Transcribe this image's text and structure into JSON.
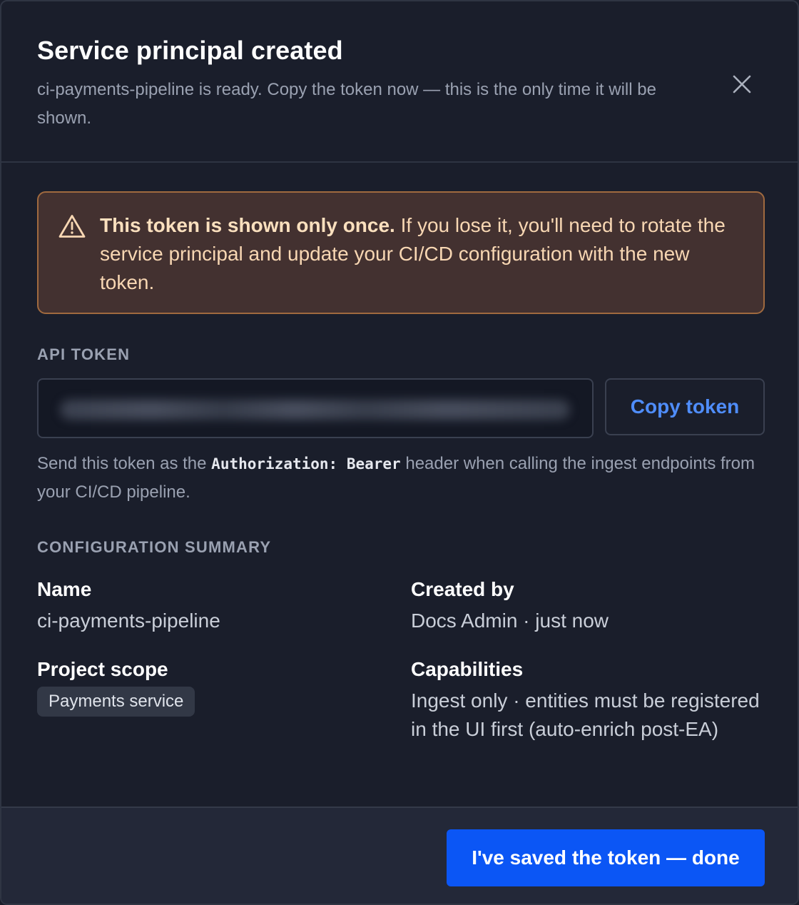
{
  "header": {
    "title": "Service principal created",
    "subtitle": "ci-payments-pipeline is ready. Copy the token now — this is the only time it will be shown.",
    "close_icon": "close-icon"
  },
  "warning": {
    "icon": "warning-triangle-icon",
    "strong": "This token is shown only once.",
    "text": " If you lose it, you'll need to rotate the service principal and update your CI/CD configuration with the new token."
  },
  "token": {
    "label": "API TOKEN",
    "value": "••••••••••••••••••••••••••••••••••••••••",
    "copy_label": "Copy token",
    "hint_before": "Send this token as the ",
    "hint_code": "Authorization: Bearer",
    "hint_after": " header when calling the ingest endpoints from your CI/CD pipeline."
  },
  "summary": {
    "label": "CONFIGURATION SUMMARY",
    "name_label": "Name",
    "name_value": "ci-payments-pipeline",
    "created_label": "Created by",
    "created_value": "Docs Admin · just now",
    "scope_label": "Project scope",
    "scope_value": "Payments service",
    "capabilities_label": "Capabilities",
    "capabilities_value": "Ingest only · entities must be registered in the UI first (auto-enrich post-EA)"
  },
  "footer": {
    "done_label": "I've saved the token — done"
  },
  "colors": {
    "background": "#1a1e2b",
    "accent": "#0b56f5",
    "link": "#4f8dfb",
    "warning_bg": "#433130",
    "warning_border": "#a06a3f"
  }
}
